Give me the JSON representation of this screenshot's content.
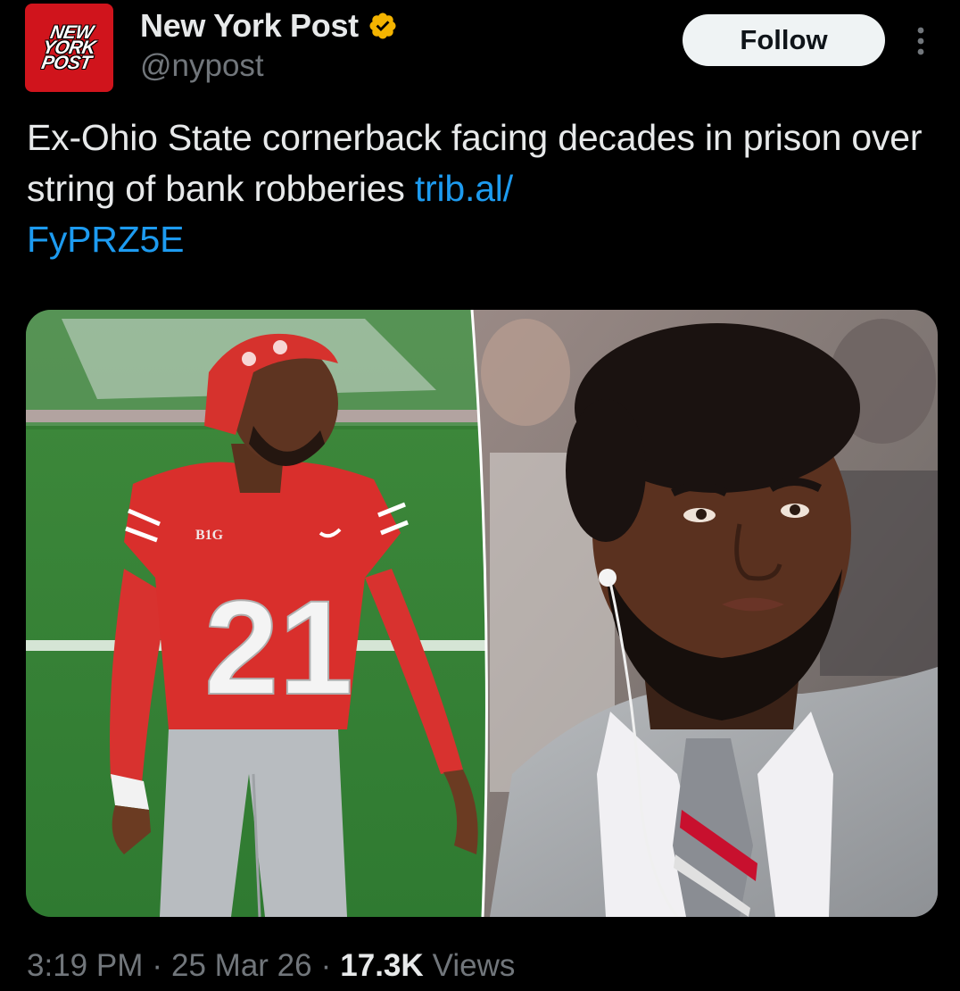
{
  "account": {
    "display_name": "New York Post",
    "handle": "@nypost",
    "avatar_logo_lines": [
      "NEW",
      "YORK",
      "POST"
    ],
    "verified": true,
    "verified_color": "#f4b400"
  },
  "actions": {
    "follow_label": "Follow",
    "more_icon": "more-vertical-icon"
  },
  "post": {
    "text": "Ex-Ohio State cornerback facing decades in prison over string of bank robberies ",
    "link_line1": "trib.al/",
    "link_line2": "FyPRZ5E",
    "link_color": "#1d9bf0"
  },
  "media": {
    "left_jersey_number": "21",
    "left_jersey_patch": "B1G"
  },
  "meta": {
    "time": "3:19 PM",
    "separator": "·",
    "date": "25 Mar 26",
    "views_count": "17.3K",
    "views_label": "Views"
  },
  "theme": {
    "background": "#000000",
    "text_primary": "#e7e9ea",
    "text_secondary": "#71767b",
    "brand_red": "#d0141c"
  }
}
